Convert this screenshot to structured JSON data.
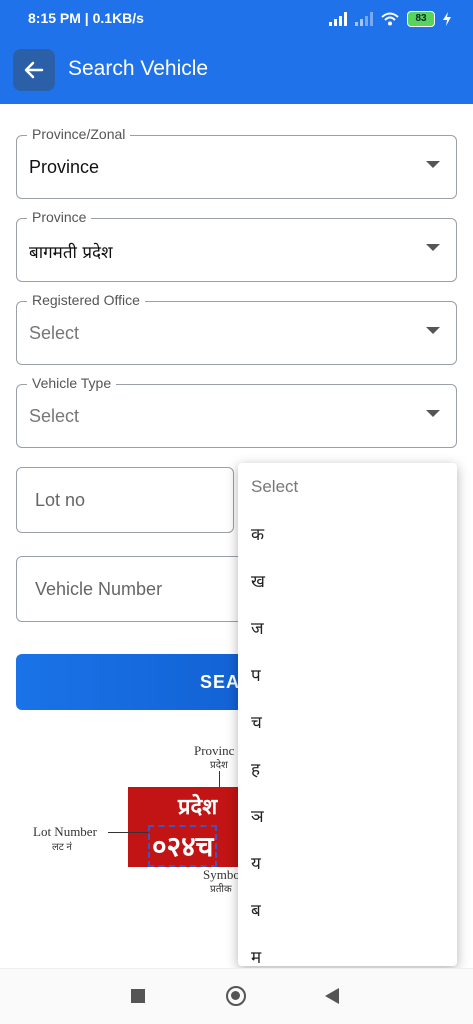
{
  "status_bar": {
    "time": "8:15 PM | 0.1KB/s",
    "battery": "83"
  },
  "header": {
    "title": "Search Vehicle"
  },
  "form": {
    "province_zonal": {
      "label": "Province/Zonal",
      "value": "Province"
    },
    "province": {
      "label": "Province",
      "value": "बागमती प्रदेश"
    },
    "registered_office": {
      "label": "Registered Office",
      "value": "Select"
    },
    "vehicle_type": {
      "label": "Vehicle Type",
      "value": "Select"
    },
    "lot_no": {
      "placeholder": "Lot no"
    },
    "vehicle_number": {
      "placeholder": "Vehicle Number"
    },
    "search_button": "SEA"
  },
  "symbol_dropdown": {
    "items": [
      "Select",
      "क",
      "ख",
      "ज",
      "प",
      "च",
      "ह",
      "ञ",
      "य",
      "ब",
      "म"
    ]
  },
  "plate_diagram": {
    "province_label": "Provinc",
    "province_label_np": "प्रदेश",
    "lot_label": "Lot Number",
    "lot_label_np": "लट नं",
    "symbol_label": "Symbo",
    "symbol_label_np": "प्रतीक",
    "plate_line1": "प्रदेश",
    "plate_line2": "०२४च"
  },
  "colors": {
    "primary": "#1f72e9",
    "plate": "#c21414"
  },
  "icons": {
    "back": "arrow-left",
    "dropdown": "caret-down",
    "nav_recent": "square",
    "nav_home": "circle",
    "nav_back": "triangle-left"
  }
}
